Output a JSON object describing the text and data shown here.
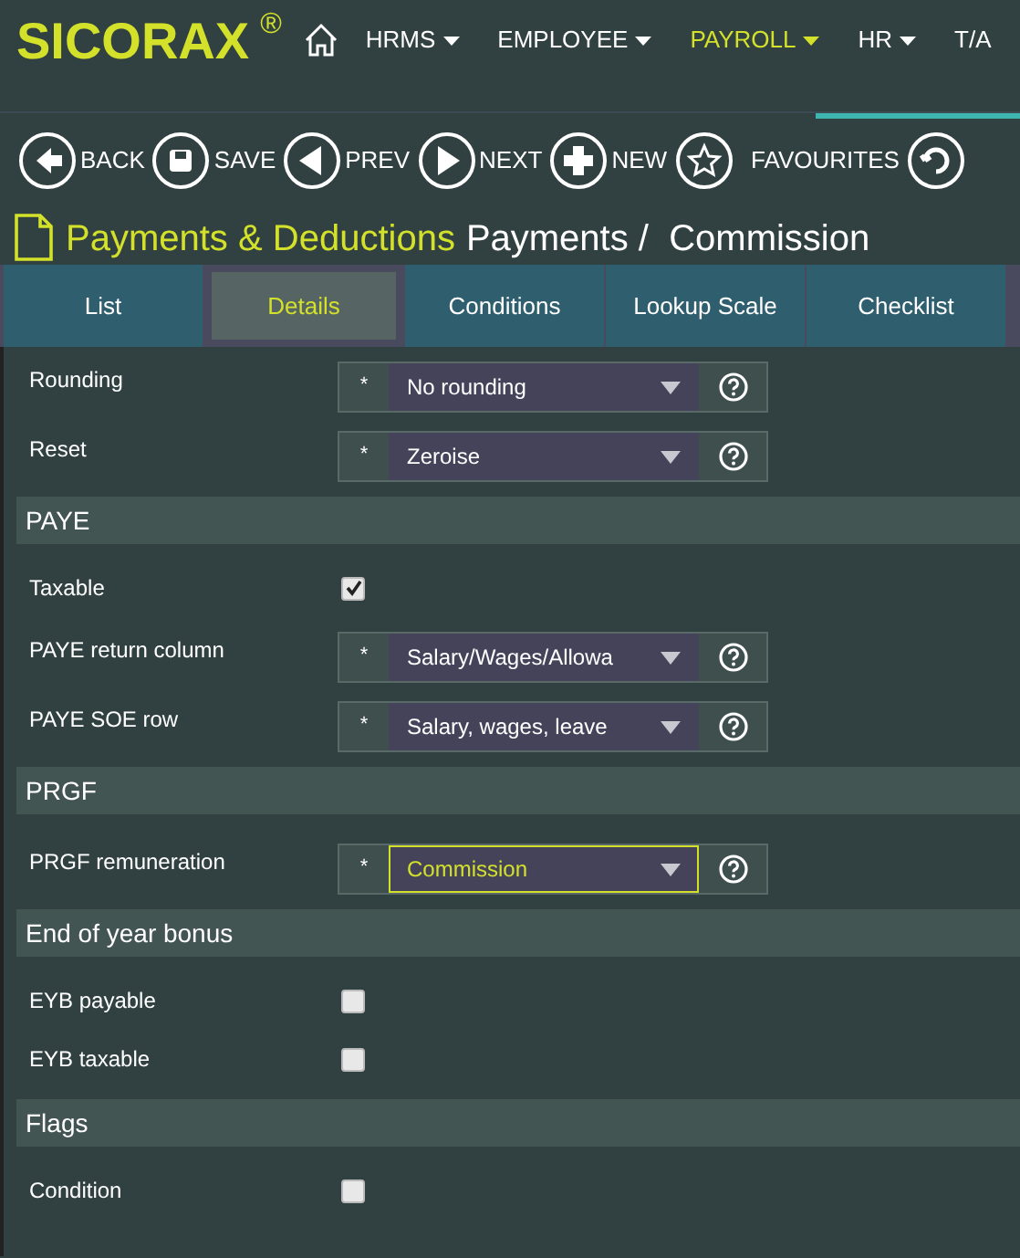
{
  "brand": {
    "name": "SICORAX",
    "mark": "®"
  },
  "nav": [
    {
      "label": "HRMS",
      "selected": false,
      "caret": true
    },
    {
      "label": "EMPLOYEE",
      "selected": false,
      "caret": true
    },
    {
      "label": "PAYROLL",
      "selected": true,
      "caret": true
    },
    {
      "label": "HR",
      "selected": false,
      "caret": true
    },
    {
      "label": "T/A",
      "selected": false,
      "caret": false
    }
  ],
  "toolbar": [
    {
      "kind": "back",
      "label": "BACK"
    },
    {
      "kind": "save",
      "label": "SAVE"
    },
    {
      "kind": "prev",
      "label": "PREV"
    },
    {
      "kind": "next",
      "label": "NEXT"
    },
    {
      "kind": "new",
      "label": "NEW"
    },
    {
      "kind": "favourites",
      "label": "FAVOURITES"
    },
    {
      "kind": "refresh"
    }
  ],
  "page_title": {
    "module": "Payments & Deductions",
    "path": "Payments /  Commission"
  },
  "tabs": [
    {
      "label": "List",
      "selected": false
    },
    {
      "label": "Details",
      "selected": true
    },
    {
      "label": "Conditions",
      "selected": false
    },
    {
      "label": "Lookup Scale",
      "selected": false
    },
    {
      "label": "Checklist",
      "selected": false
    }
  ],
  "form": [
    {
      "kind": "select",
      "label": "Rounding",
      "required": "*",
      "value": "No rounding",
      "focused": false
    },
    {
      "kind": "select",
      "label": "Reset",
      "required": "*",
      "value": "Zeroise",
      "focused": false
    },
    {
      "kind": "section",
      "label": "PAYE"
    },
    {
      "kind": "checkbox",
      "label": "Taxable",
      "checked": true
    },
    {
      "kind": "select",
      "label": "PAYE return column",
      "required": "*",
      "value": "Salary/Wages/Allowa",
      "focused": false
    },
    {
      "kind": "select",
      "label": "PAYE SOE row",
      "required": "*",
      "value": "Salary, wages, leave",
      "focused": false
    },
    {
      "kind": "section",
      "label": "PRGF"
    },
    {
      "kind": "select",
      "label": "PRGF remuneration",
      "required": "*",
      "value": "Commission",
      "focused": true
    },
    {
      "kind": "section",
      "label": "End of year bonus"
    },
    {
      "kind": "checkbox",
      "label": "EYB payable",
      "checked": false
    },
    {
      "kind": "checkbox",
      "label": "EYB taxable",
      "checked": false
    },
    {
      "kind": "section",
      "label": "Flags"
    },
    {
      "kind": "checkbox",
      "label": "Condition",
      "checked": false
    }
  ]
}
